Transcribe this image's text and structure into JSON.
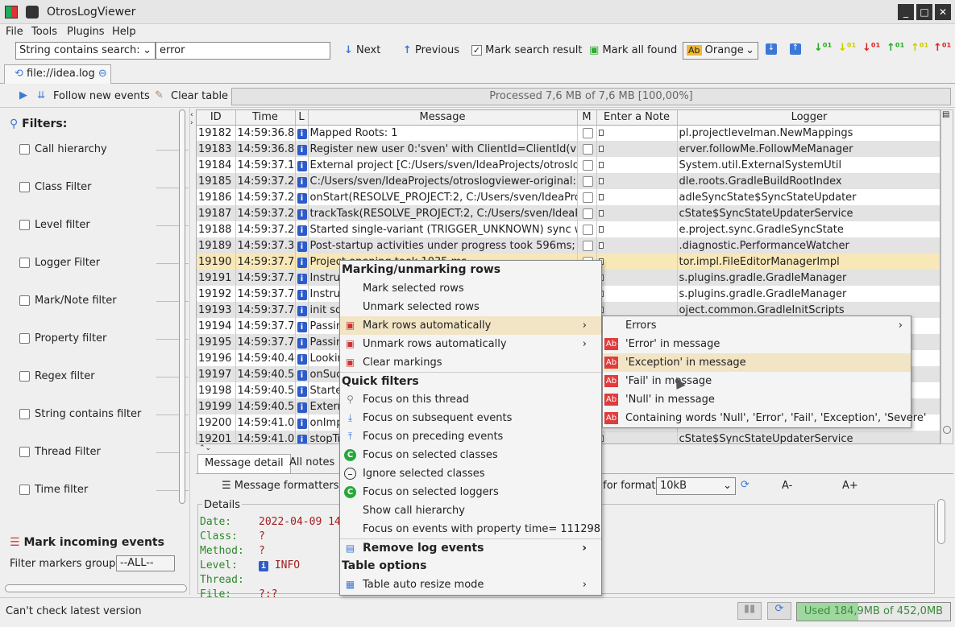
{
  "app": {
    "title": "OtrosLogViewer"
  },
  "menu": [
    "File",
    "Tools",
    "Plugins",
    "Help"
  ],
  "toolbar": {
    "search_mode": "String contains search:",
    "search_value": "error",
    "next": "Next",
    "previous": "Previous",
    "mark_search": "Mark search result",
    "mark_all": "Mark all found",
    "color": "Orange"
  },
  "tab": {
    "label": "file://idea.log"
  },
  "subbar": {
    "follow": "Follow new events",
    "clear": "Clear table",
    "progress": "Processed 7,6 MB of 7,6 MB [100,00%]"
  },
  "sidebar": {
    "filters_title": "Filters:",
    "filters": [
      "Call hierarchy",
      "Class Filter",
      "Level filter",
      "Logger Filter",
      "Mark/Note filter",
      "Property filter",
      "Regex filter",
      "String contains filter",
      "Thread Filter",
      "Time filter"
    ],
    "mark_title": "Mark incoming events",
    "group_label": "Filter markers group:",
    "group_value": "--ALL--"
  },
  "table": {
    "headers": [
      "ID",
      "Time",
      "L",
      "Message",
      "M",
      "Enter a Note",
      "Logger"
    ],
    "rows": [
      [
        "19182",
        "14:59:36.826",
        "Mapped Roots: 1",
        "pl.projectlevelman.NewMappings"
      ],
      [
        "19183",
        "14:59:36.843",
        "Register new user 0:'sven' with ClientId=ClientId(value...",
        "erver.followMe.FollowMeManager"
      ],
      [
        "19184",
        "14:59:37.153",
        "External project [C:/Users/sven/IdeaProjects/otroslog...",
        "System.util.ExternalSystemUtil"
      ],
      [
        "19185",
        "14:59:37.242",
        "C:/Users/sven/IdeaProjects/otroslogviewer-original: n...",
        "dle.roots.GradleBuildRootIndex"
      ],
      [
        "19186",
        "14:59:37.244",
        "onStart(RESOLVE_PROJECT:2, C:/Users/sven/IdeaProj...",
        "adleSyncState$SyncStateUpdater"
      ],
      [
        "19187",
        "14:59:37.245",
        "trackTask(RESOLVE_PROJECT:2, C:/Users/sven/IdeaPr...",
        "cState$SyncStateUpdaterService"
      ],
      [
        "19188",
        "14:59:37.245",
        "Started single-variant (TRIGGER_UNKNOWN) sync wit...",
        "e.project.sync.GradleSyncState"
      ],
      [
        "19189",
        "14:59:37.361",
        "Post-startup activities under progress took 596ms; ge...",
        ".diagnostic.PerformanceWatcher"
      ],
      [
        "19190",
        "14:59:37.710",
        "Project opening took 1035 ms",
        "tor.impl.FileEditorManagerImpl"
      ],
      [
        "19191",
        "14:59:37.727",
        "Instru",
        "s.plugins.gradle.GradleManager"
      ],
      [
        "19192",
        "14:59:37.729",
        "Instru",
        "s.plugins.gradle.GradleManager"
      ],
      [
        "19193",
        "14:59:37.748",
        "init scr",
        "oject.common.GradleInitScripts"
      ],
      [
        "19194",
        "14:59:37.773",
        "Passin",
        ""
      ],
      [
        "19195",
        "14:59:37.779",
        "Passin",
        ""
      ],
      [
        "19196",
        "14:59:40.444",
        "Lookin",
        ""
      ],
      [
        "19197",
        "14:59:40.540",
        "onSucc",
        ""
      ],
      [
        "19198",
        "14:59:40.541",
        "Started",
        ""
      ],
      [
        "19199",
        "14:59:40.554",
        "Extern",
        ""
      ],
      [
        "19200",
        "14:59:41.077",
        "onImp",
        ""
      ],
      [
        "19201",
        "14:59:41.079",
        "stopTr",
        "cState$SyncStateUpdaterService"
      ]
    ]
  },
  "bottom": {
    "tab1": "Message detail",
    "tab2": "All notes",
    "formatters": "Message formatters",
    "format_label": "e for format",
    "format_value": "10kB",
    "a_minus": "A-",
    "a_plus": "A+",
    "details": "Details",
    "detail_lines": [
      [
        "Date:",
        "2022-04-09 14"
      ],
      [
        "Class:",
        "?"
      ],
      [
        "Method:",
        "?"
      ],
      [
        "Level:",
        "INFO"
      ],
      [
        "Thread:",
        ""
      ],
      [
        "File:",
        "?:?"
      ]
    ]
  },
  "status": {
    "message": "Can't check latest version",
    "memory": "Used 184,9MB of 452,0MB"
  },
  "context_menu": {
    "h1": "Marking/unmarking rows",
    "mark_sel": "Mark selected rows",
    "unmark_sel": "Unmark selected rows",
    "mark_auto": "Mark rows automatically",
    "unmark_auto": "Unmark rows automatically",
    "clear": "Clear markings",
    "h2": "Quick filters",
    "thread": "Focus on this thread",
    "subsequent": "Focus on subsequent events",
    "preceding": "Focus on preceding events",
    "sel_classes": "Focus on selected classes",
    "ignore_classes": "Ignore selected classes",
    "sel_loggers": "Focus on selected loggers",
    "call_hier": "Show call hierarchy",
    "prop": "Focus on events with property time= 111298",
    "remove": "Remove log events",
    "h3": "Table options",
    "resize": "Table auto resize mode"
  },
  "submenu": {
    "errors": "Errors",
    "items": [
      "'Error' in message",
      "'Exception' in message",
      "'Fail' in message",
      "'Null' in message",
      "Containing words 'Null', 'Error', 'Fail', 'Exception', 'Severe'"
    ],
    "ab_icon": "Ab"
  }
}
